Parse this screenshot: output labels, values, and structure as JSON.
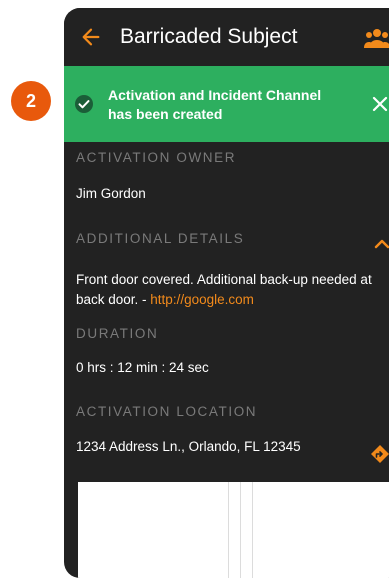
{
  "header": {
    "title": "Barricaded Subject",
    "back_icon": "arrow-left-icon",
    "group_icon": "group-icon"
  },
  "notification": {
    "message": "Activation and Incident Channel has been created",
    "check_icon": "check-circle-icon",
    "close_icon": "close-icon"
  },
  "step_badge": "2",
  "sections": {
    "owner": {
      "label": "ACTIVATION OWNER",
      "value": "Jim Gordon"
    },
    "details": {
      "label": "ADDITIONAL DETAILS",
      "text": "Front door covered. Additional back-up needed at back door. - ",
      "link": "http://google.com",
      "toggle_icon": "chevron-up-icon"
    },
    "duration": {
      "label": "DURATION",
      "value": "0 hrs : 12 min : 24 sec"
    },
    "location": {
      "label": "ACTIVATION LOCATION",
      "address": "1234 Address Ln., Orlando, FL 12345",
      "directions_icon": "directions-icon"
    }
  },
  "colors": {
    "accent": "#f28a1b",
    "success": "#2daf5f",
    "badge": "#e8590c",
    "background": "#222222",
    "muted_label": "#7a7a7a"
  }
}
